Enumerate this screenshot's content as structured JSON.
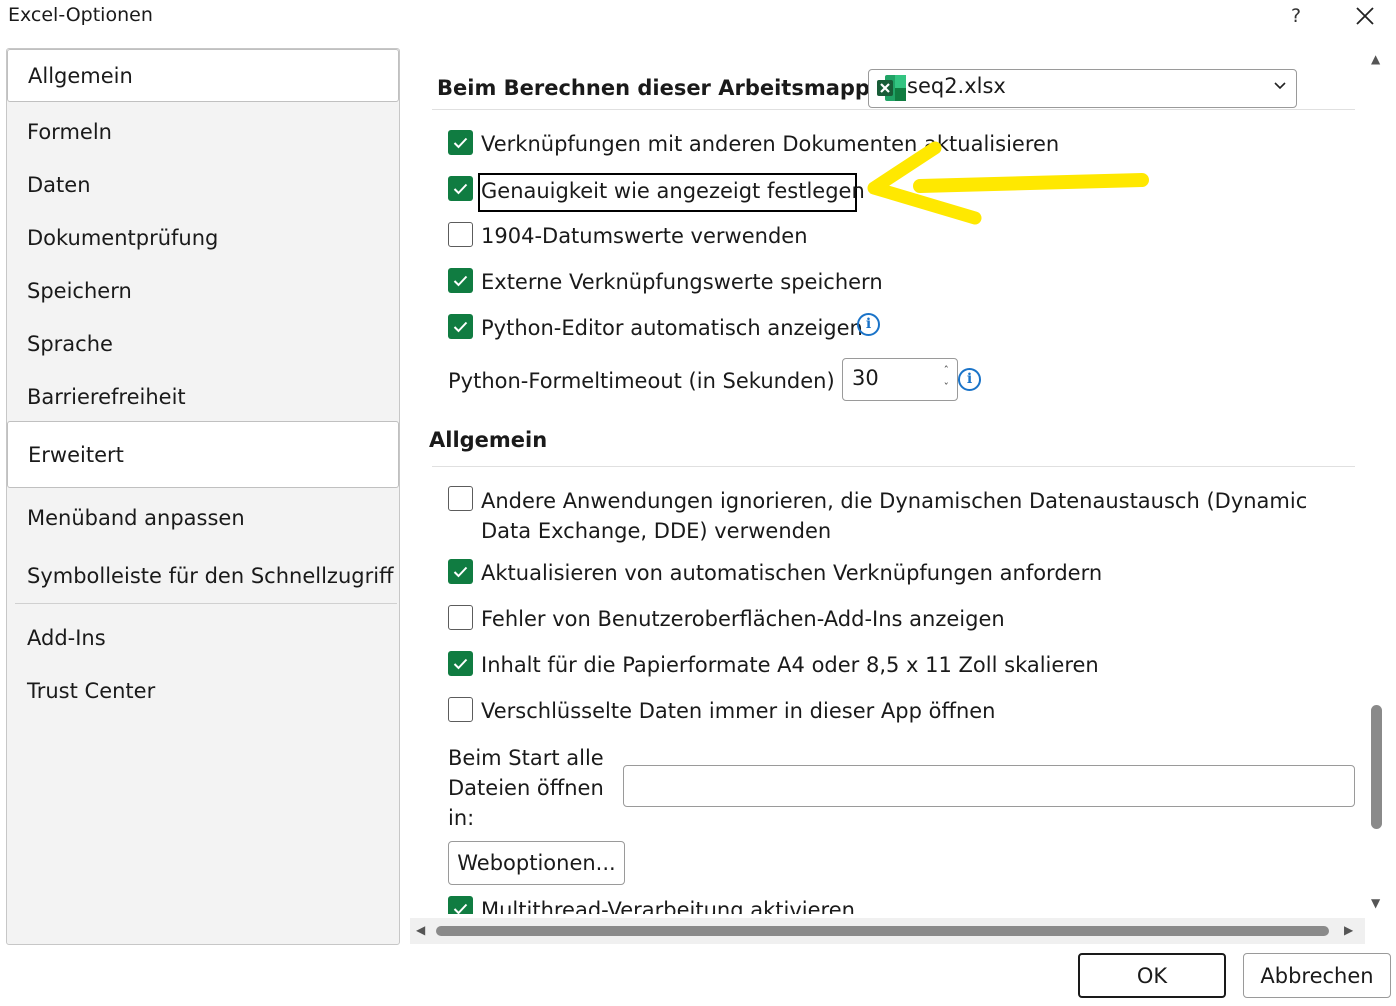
{
  "window": {
    "title": "Excel-Optionen",
    "help_label": "?"
  },
  "sidebar": {
    "items": [
      {
        "label": "Allgemein"
      },
      {
        "label": "Formeln"
      },
      {
        "label": "Daten"
      },
      {
        "label": "Dokumentprüfung"
      },
      {
        "label": "Speichern"
      },
      {
        "label": "Sprache"
      },
      {
        "label": "Barrierefreiheit"
      },
      {
        "label": "Erweitert",
        "selected": true
      },
      {
        "label": "Menüband anpassen"
      },
      {
        "label": "Symbolleiste für den Schnellzugriff"
      },
      {
        "label": "Add-Ins"
      },
      {
        "label": "Trust Center"
      }
    ]
  },
  "calc": {
    "heading": "Beim Berechnen dieser Arbeitsmappe:",
    "workbook": "seq2.xlsx",
    "options": [
      {
        "label": "Verknüpfungen mit anderen Dokumenten aktualisieren",
        "checked": true
      },
      {
        "label": "Genauigkeit wie angezeigt festlegen",
        "checked": true,
        "focused": true
      },
      {
        "label": "1904-Datumswerte verwenden",
        "checked": false
      },
      {
        "label": "Externe Verknüpfungswerte speichern",
        "checked": true
      },
      {
        "label": "Python-Editor automatisch anzeigen",
        "checked": true
      }
    ],
    "timeout_label": "Python-Formeltimeout (in Sekunden)",
    "timeout_value": "30",
    "info_glyph": "i"
  },
  "general": {
    "heading": "Allgemein",
    "options": [
      {
        "label": "Andere Anwendungen ignorieren, die Dynamischen Datenaustausch (Dynamic Data Exchange, DDE) verwenden",
        "checked": false
      },
      {
        "label": "Aktualisieren von automatischen Verknüpfungen anfordern",
        "checked": true
      },
      {
        "label": "Fehler von Benutzeroberflächen-Add-Ins anzeigen",
        "checked": false
      },
      {
        "label": "Inhalt für die Papierformate A4 oder 8,5 x 11 Zoll skalieren",
        "checked": true
      },
      {
        "label": "Verschlüsselte Daten immer in dieser App öffnen",
        "checked": false
      }
    ],
    "startup_label": "Beim Start alle Dateien öffnen in:",
    "startup_value": "",
    "web_options_label": "Weboptionen...",
    "multithread_label": "Multithread-Verarbeitung aktivieren",
    "multithread_checked": true
  },
  "footer": {
    "ok_label": "OK",
    "cancel_label": "Abbrechen"
  },
  "colors": {
    "checkbox_checked": "#107c41",
    "annotation_arrow": "#ffe800",
    "info_icon": "#1a73c8"
  }
}
